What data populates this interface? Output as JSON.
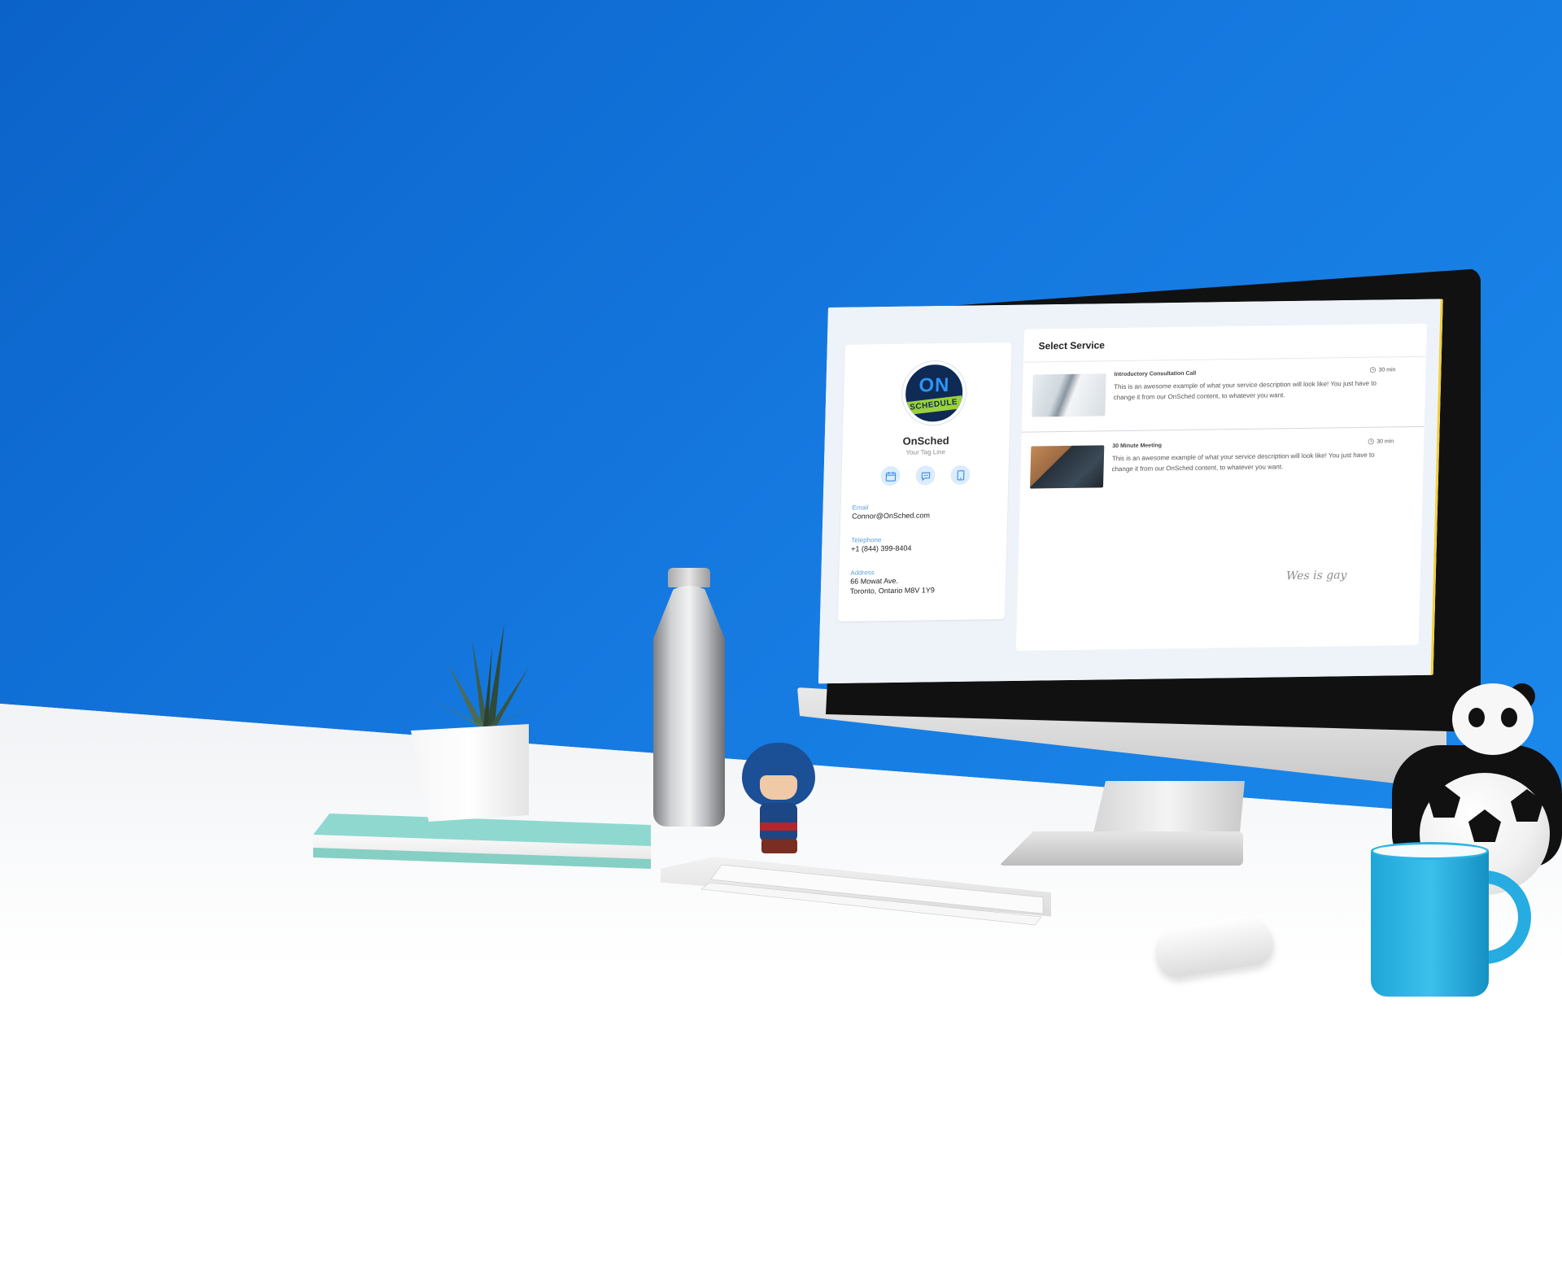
{
  "sidebar": {
    "business_name": "OnSched",
    "tag_line": "Your Tag Line",
    "logo_text_top": "ON",
    "logo_text_band": "SCHEDULE",
    "contact": [
      {
        "label": "Email",
        "value": "Connor@OnSched.com"
      },
      {
        "label": "Telephone",
        "value": "+1 (844) 399-8404"
      },
      {
        "label": "Address",
        "value": "66 Mowat Ave.",
        "value2": "Toronto, Ontario M8V 1Y9"
      }
    ],
    "action_icons": [
      "calendar-icon",
      "chat-icon",
      "tablet-icon"
    ]
  },
  "main": {
    "title": "Select Service",
    "services": [
      {
        "name": "Introductory Consultation Call",
        "duration": "30 min",
        "description": "This is an awesome example of what your service description will look like! You just have to change it from our OnSched content, to whatever you want."
      },
      {
        "name": "30 Minute Meeting",
        "duration": "30 min",
        "description": "This is an awesome example of what your service description will look like! You just have to change it from our OnSched content, to whatever you want."
      }
    ],
    "handwritten_note": "Wes is gay"
  },
  "colors": {
    "background_blue": "#1579e0",
    "accent_blue": "#5c9ed8",
    "icon_bg": "#dcecfb",
    "logo_navy": "#0e2a55",
    "logo_green": "#9bd13b"
  }
}
